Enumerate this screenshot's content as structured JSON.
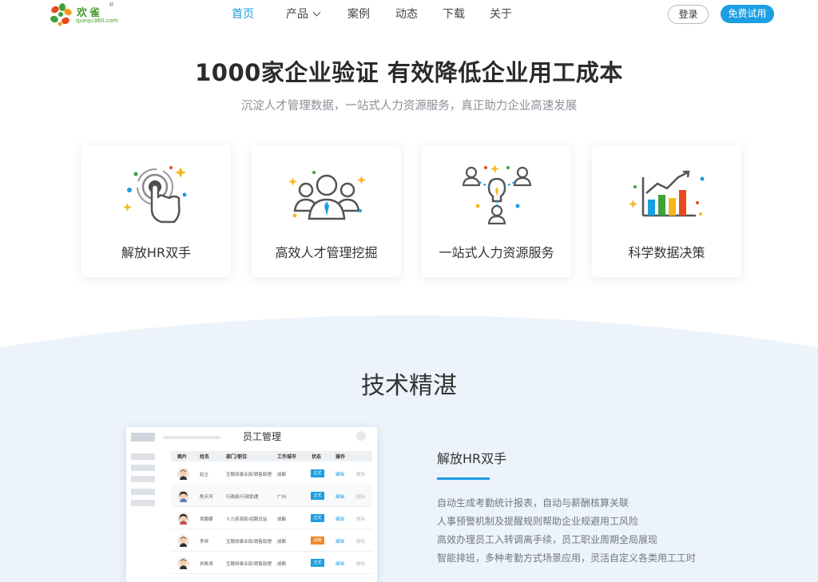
{
  "brand": {
    "name": "欢雀",
    "reg": "®",
    "url": "quequ360.com"
  },
  "nav": {
    "items": [
      {
        "label": "首页",
        "active": true
      },
      {
        "label": "产品",
        "has_dropdown": true
      },
      {
        "label": "案例"
      },
      {
        "label": "动态"
      },
      {
        "label": "下载"
      },
      {
        "label": "关于"
      }
    ],
    "login_label": "登录",
    "trial_label": "免费试用"
  },
  "hero": {
    "title": "1000家企业验证 有效降低企业用工成本",
    "subtitle": "沉淀人才管理数据，一站式人力资源服务，真正助力企业高速发展"
  },
  "features": [
    {
      "label": "解放HR双手",
      "icon": "touch-hand-icon"
    },
    {
      "label": "高效人才管理挖掘",
      "icon": "team-people-icon"
    },
    {
      "label": "一站式人力资源服务",
      "icon": "lightbulb-network-icon"
    },
    {
      "label": "科学数据决策",
      "icon": "bar-chart-growth-icon"
    }
  ],
  "tech": {
    "title": "技术精湛",
    "mockup": {
      "title": "员工管理",
      "columns": [
        "图片",
        "姓名",
        "部门/职位",
        "工作城市",
        "状态",
        "操作"
      ],
      "rows": [
        {
          "name": "赵立",
          "dept": "互联网事业部/销售助理",
          "city": "成都",
          "status": "正式",
          "status_color": "blue",
          "edit": "编辑",
          "del": "删除"
        },
        {
          "name": "陈天河",
          "dept": "行政部/行政助理",
          "city": "广州",
          "status": "正式",
          "status_color": "blue",
          "edit": "编辑",
          "del": "删除"
        },
        {
          "name": "吴娜娜",
          "dept": "人力资源部/招聘总监",
          "city": "成都",
          "status": "正式",
          "status_color": "blue",
          "edit": "编辑",
          "del": "删除"
        },
        {
          "name": "李恒",
          "dept": "互联网事业部/销售助理",
          "city": "成都",
          "status": "试用",
          "status_color": "orange",
          "edit": "编辑",
          "del": "删除"
        },
        {
          "name": "刘希涛",
          "dept": "互联网事业部/销售助理",
          "city": "成都",
          "status": "正式",
          "status_color": "blue",
          "edit": "编辑",
          "del": "删除"
        }
      ]
    },
    "feature_title": "解放HR双手",
    "feature_items": [
      "自动生成考勤统计报表，自动与薪酬核算关联",
      "人事预警机制及提醒规则帮助企业规避用工风险",
      "高效办理员工入转调离手续，员工职业周期全局展现",
      "智能排班，多种考勤方式场景应用，灵活自定义各类用工工时"
    ]
  },
  "colors": {
    "accent": "#1c9ee3",
    "tech_bg": "#edf3fa",
    "orange": "#f08a24"
  }
}
